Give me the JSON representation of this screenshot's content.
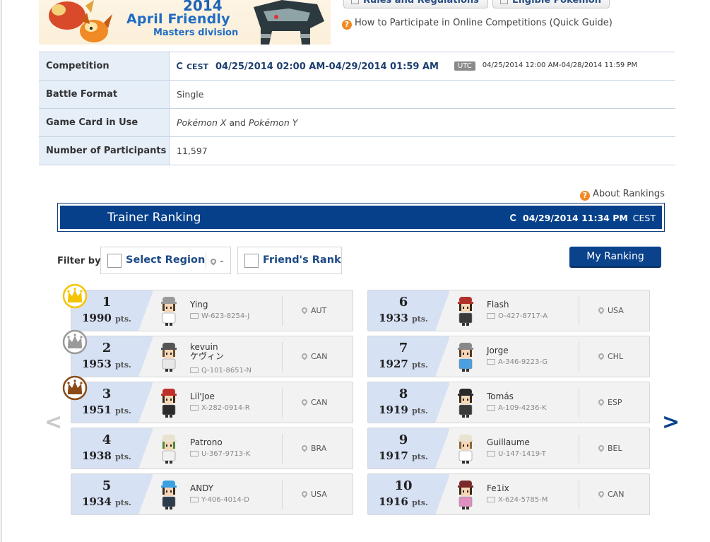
{
  "banner": {
    "year": "2014",
    "title": "April Friendly",
    "subtitle": "Masters division"
  },
  "top_buttons": {
    "rules": "Rules and Regulations",
    "eligible": "Eligible Pokémon"
  },
  "help_link": "How to Participate in Online Competitions (Quick Guide)",
  "info": {
    "competition_label": "Competition",
    "cest_tag": "CEST",
    "cest_time": "04/25/2014 02:00 AM-04/29/2014 01:59 AM",
    "utc_tag": "UTC",
    "utc_time": "04/25/2014 12:00 AM-04/28/2014 11:59 PM",
    "format_label": "Battle Format",
    "format_value": "Single",
    "gamecard_label": "Game Card in Use",
    "gamecard_a": "Pokémon X",
    "gamecard_and": " and ",
    "gamecard_b": "Pokémon Y",
    "participants_label": "Number of Participants",
    "participants_value": "11,597"
  },
  "about_rankings": "About Rankings",
  "ranking": {
    "title": "Trainer Ranking",
    "updated_time": "04/29/2014 11:34 PM",
    "updated_tz": "CEST",
    "filter_label": "Filter by:",
    "region_label": "Select Region",
    "region_value": "-",
    "friend_label": "Friend's Rank",
    "my_ranking": "My Ranking",
    "prev": "<",
    "next": ">",
    "pts_unit": "pts.",
    "entries": [
      {
        "rank": "1",
        "points": "1990",
        "name": "Ying",
        "name2": "",
        "id": "W-623-8254-J",
        "country": "AUT"
      },
      {
        "rank": "2",
        "points": "1953",
        "name": "kevuin",
        "name2": "ケヴィン",
        "id": "Q-101-8651-N",
        "country": "CAN"
      },
      {
        "rank": "3",
        "points": "1951",
        "name": "Lil'Joe",
        "name2": "",
        "id": "X-282-0914-R",
        "country": "CAN"
      },
      {
        "rank": "4",
        "points": "1938",
        "name": "Patrono",
        "name2": "",
        "id": "U-367-9713-K",
        "country": "BRA"
      },
      {
        "rank": "5",
        "points": "1934",
        "name": "ANDY",
        "name2": "",
        "id": "Y-406-4014-D",
        "country": "USA"
      },
      {
        "rank": "6",
        "points": "1933",
        "name": "Flash",
        "name2": "",
        "id": "O-427-8717-A",
        "country": "USA"
      },
      {
        "rank": "7",
        "points": "1927",
        "name": "Jorge",
        "name2": "",
        "id": "A-346-9223-G",
        "country": "CHL"
      },
      {
        "rank": "8",
        "points": "1919",
        "name": "Tomás",
        "name2": "",
        "id": "A-109-4236-K",
        "country": "ESP"
      },
      {
        "rank": "9",
        "points": "1917",
        "name": "Guillaume",
        "name2": "",
        "id": "U-147-1419-T",
        "country": "BEL"
      },
      {
        "rank": "10",
        "points": "1916",
        "name": "Fe1ix",
        "name2": "",
        "id": "X-624-5785-M",
        "country": "CAN"
      }
    ]
  },
  "colors": {
    "primary_blue": "#06408a",
    "rank_panel": "#d6e1f4",
    "gold": "#f5c400",
    "silver": "#9a9a9a",
    "bronze": "#8b4a16",
    "help_orange": "#f08a24"
  }
}
